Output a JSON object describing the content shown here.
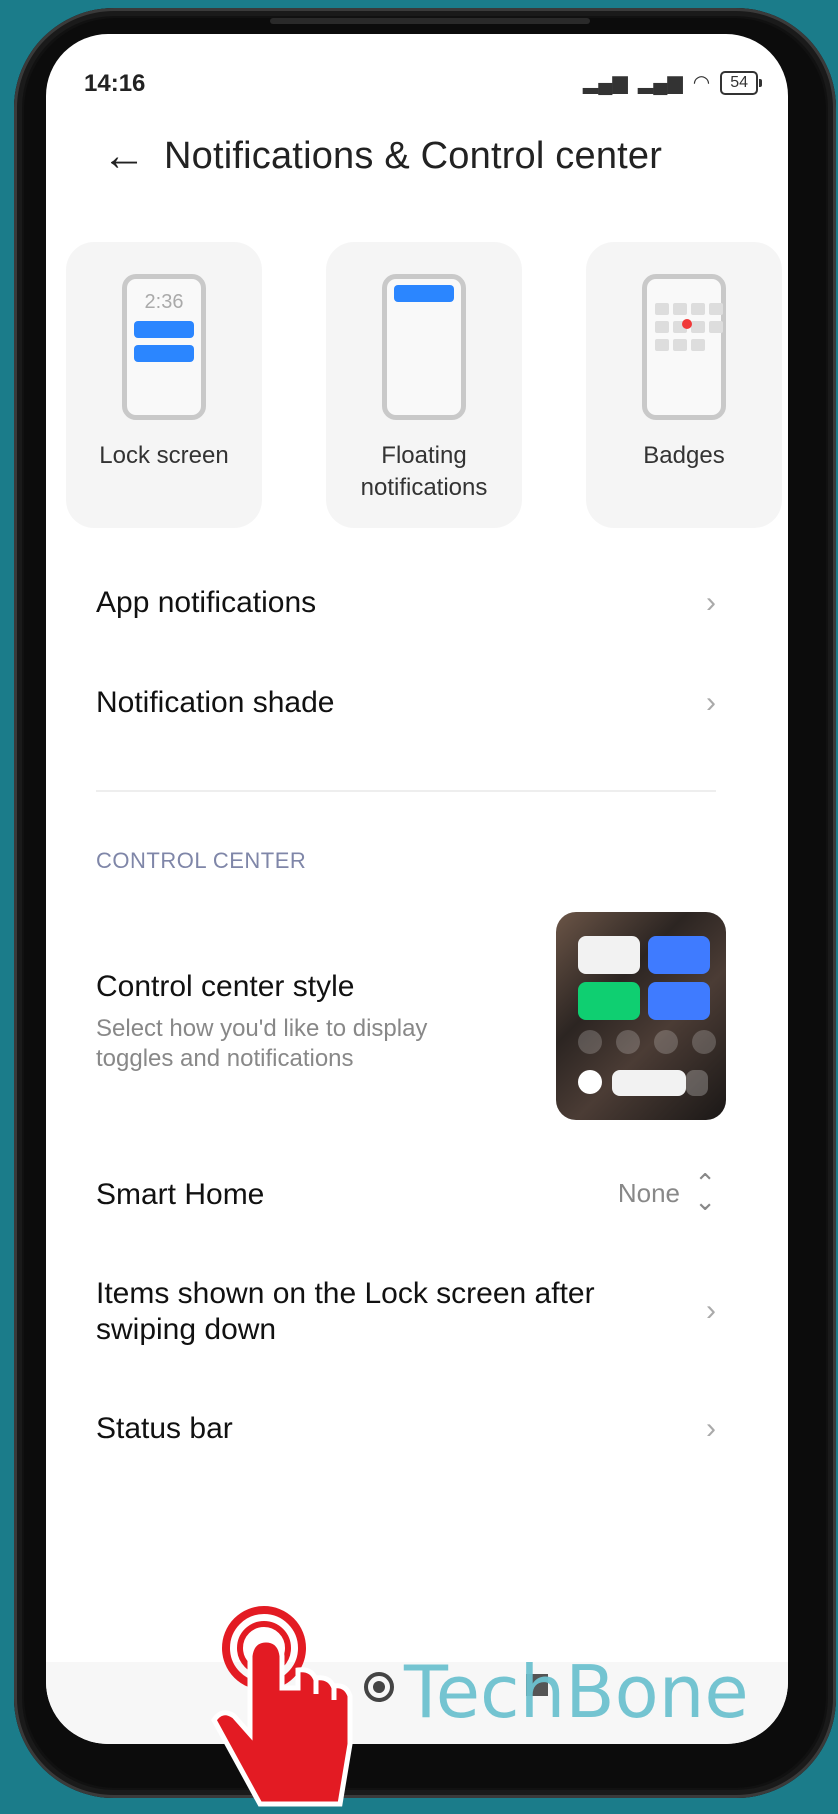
{
  "status": {
    "time": "14:16",
    "battery": "54"
  },
  "header": {
    "title": "Notifications & Control center"
  },
  "cards": [
    {
      "label": "Lock screen",
      "mock_time": "2:36"
    },
    {
      "label": "Floating notifications"
    },
    {
      "label": "Badges"
    }
  ],
  "menu": {
    "app_notifications": "App notifications",
    "notification_shade": "Notification shade"
  },
  "section_title": "CONTROL CENTER",
  "control_center_style": {
    "title": "Control center style",
    "subtitle": "Select how you'd like to display toggles and notifications"
  },
  "smart_home": {
    "label": "Smart Home",
    "value": "None"
  },
  "items_lock_screen": {
    "label": "Items shown on the Lock screen after swiping down"
  },
  "status_bar": {
    "label": "Status bar"
  },
  "watermark": "TechBone",
  "colors": {
    "accent": "#2b86ff",
    "badge_red": "#f03838",
    "section": "#7f86a8",
    "tap_hand": "#e31b23"
  }
}
